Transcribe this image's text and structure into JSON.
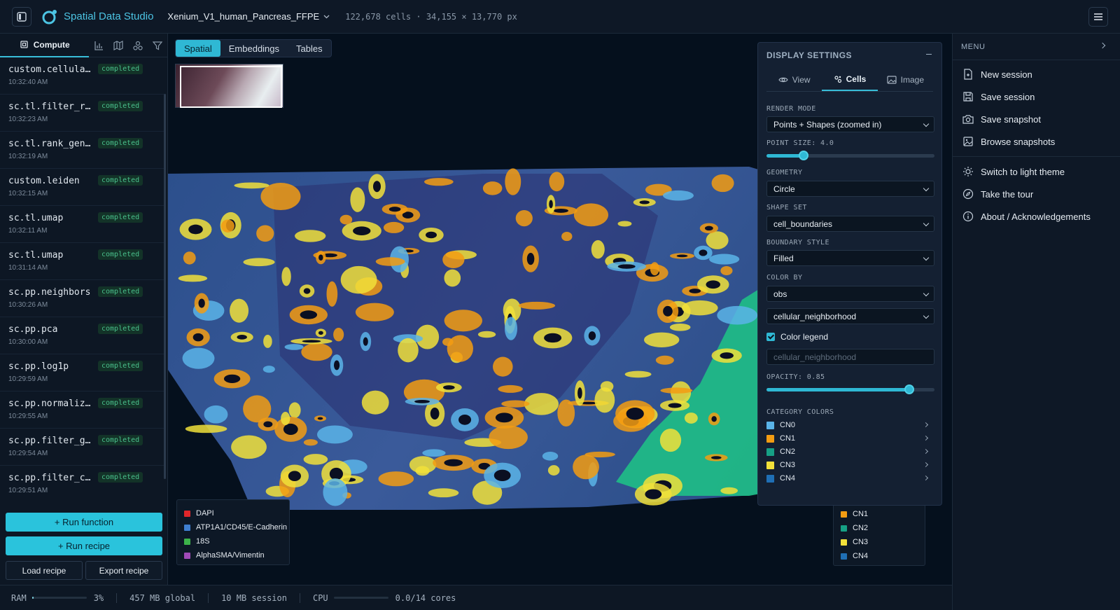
{
  "app": {
    "title": "Spatial Data Studio",
    "dataset": "Xenium_V1_human_Pancreas_FFPE",
    "dataset_meta": "122,678 cells · 34,155 × 13,770 px"
  },
  "left_panel": {
    "tab_compute": "Compute",
    "tab_icons": [
      "bar-chart-icon",
      "map-icon",
      "shapes-icon",
      "filter-icon"
    ],
    "history": [
      {
        "name": "custom.cellular_neighborhood",
        "status": "completed",
        "time": "10:32:40 AM"
      },
      {
        "name": "sc.tl.filter_rank_genes_groups",
        "status": "completed",
        "time": "10:32:23 AM"
      },
      {
        "name": "sc.tl.rank_genes_groups",
        "status": "completed",
        "time": "10:32:19 AM"
      },
      {
        "name": "custom.leiden",
        "status": "completed",
        "time": "10:32:15 AM"
      },
      {
        "name": "sc.tl.umap",
        "status": "completed",
        "time": "10:32:11 AM"
      },
      {
        "name": "sc.tl.umap",
        "status": "completed",
        "time": "10:31:14 AM"
      },
      {
        "name": "sc.pp.neighbors",
        "status": "completed",
        "time": "10:30:26 AM"
      },
      {
        "name": "sc.pp.pca",
        "status": "completed",
        "time": "10:30:00 AM"
      },
      {
        "name": "sc.pp.log1p",
        "status": "completed",
        "time": "10:29:59 AM"
      },
      {
        "name": "sc.pp.normalize_total",
        "status": "completed",
        "time": "10:29:55 AM"
      },
      {
        "name": "sc.pp.filter_genes",
        "status": "completed",
        "time": "10:29:54 AM"
      },
      {
        "name": "sc.pp.filter_cells",
        "status": "completed",
        "time": "10:29:51 AM"
      }
    ],
    "run_function": "+ Run function",
    "run_recipe": "+ Run recipe",
    "load_recipe": "Load recipe",
    "export_recipe": "Export recipe"
  },
  "status_bar": {
    "ram_label": "RAM",
    "ram_percent": "3%",
    "ram_fraction": 0.03,
    "global_mem": "457 MB global",
    "session_mem": "10 MB session",
    "cpu_label": "CPU",
    "cpu_value": "0.0/14 cores",
    "cpu_fraction": 0.0
  },
  "main": {
    "tabs": [
      "Spatial",
      "Embeddings",
      "Tables"
    ],
    "active_tab": "Spatial",
    "channel_legend": [
      {
        "label": "DAPI",
        "color": "#e0262a"
      },
      {
        "label": "ATP1A1/CD45/E-Cadherin",
        "color": "#3f7fd0"
      },
      {
        "label": "18S",
        "color": "#3cb24a"
      },
      {
        "label": "AlphaSMA/Vimentin",
        "color": "#a04ab8"
      }
    ],
    "category_legend": [
      {
        "label": "CN0",
        "color": "#5ab4e8"
      },
      {
        "label": "CN1",
        "color": "#f39c12"
      },
      {
        "label": "CN2",
        "color": "#16a085"
      },
      {
        "label": "CN3",
        "color": "#f1e03a"
      },
      {
        "label": "CN4",
        "color": "#1f6fb5"
      }
    ]
  },
  "display_settings": {
    "title": "DISPLAY SETTINGS",
    "tabs": [
      "View",
      "Cells",
      "Image"
    ],
    "active_tab": "Cells",
    "render_mode_label": "RENDER MODE",
    "render_mode": "Points + Shapes (zoomed in)",
    "point_size_label": "POINT SIZE: 4.0",
    "point_size_fraction": 0.22,
    "geometry_label": "GEOMETRY",
    "geometry": "Circle",
    "shape_set_label": "SHAPE SET",
    "shape_set": "cell_boundaries",
    "boundary_style_label": "BOUNDARY STYLE",
    "boundary_style": "Filled",
    "color_by_label": "COLOR BY",
    "color_by": "obs",
    "color_by_field": "cellular_neighborhood",
    "color_legend_label": "Color legend",
    "legend_title_placeholder": "cellular_neighborhood",
    "opacity_label": "OPACITY: 0.85",
    "opacity_fraction": 0.85,
    "category_colors_label": "CATEGORY COLORS",
    "categories": [
      {
        "label": "CN0",
        "color": "#5ab4e8"
      },
      {
        "label": "CN1",
        "color": "#f39c12"
      },
      {
        "label": "CN2",
        "color": "#16a085"
      },
      {
        "label": "CN3",
        "color": "#f1e03a"
      },
      {
        "label": "CN4",
        "color": "#1f6fb5"
      }
    ]
  },
  "menu": {
    "title": "MENU",
    "items": [
      {
        "label": "New session",
        "icon": "file-plus-icon"
      },
      {
        "label": "Save session",
        "icon": "save-icon"
      },
      {
        "label": "Save snapshot",
        "icon": "camera-icon"
      },
      {
        "label": "Browse snapshots",
        "icon": "image-icon"
      },
      {
        "label": "Switch to light theme",
        "icon": "sun-icon"
      },
      {
        "label": "Take the tour",
        "icon": "compass-icon"
      },
      {
        "label": "About / Acknowledgements",
        "icon": "info-icon"
      }
    ]
  }
}
